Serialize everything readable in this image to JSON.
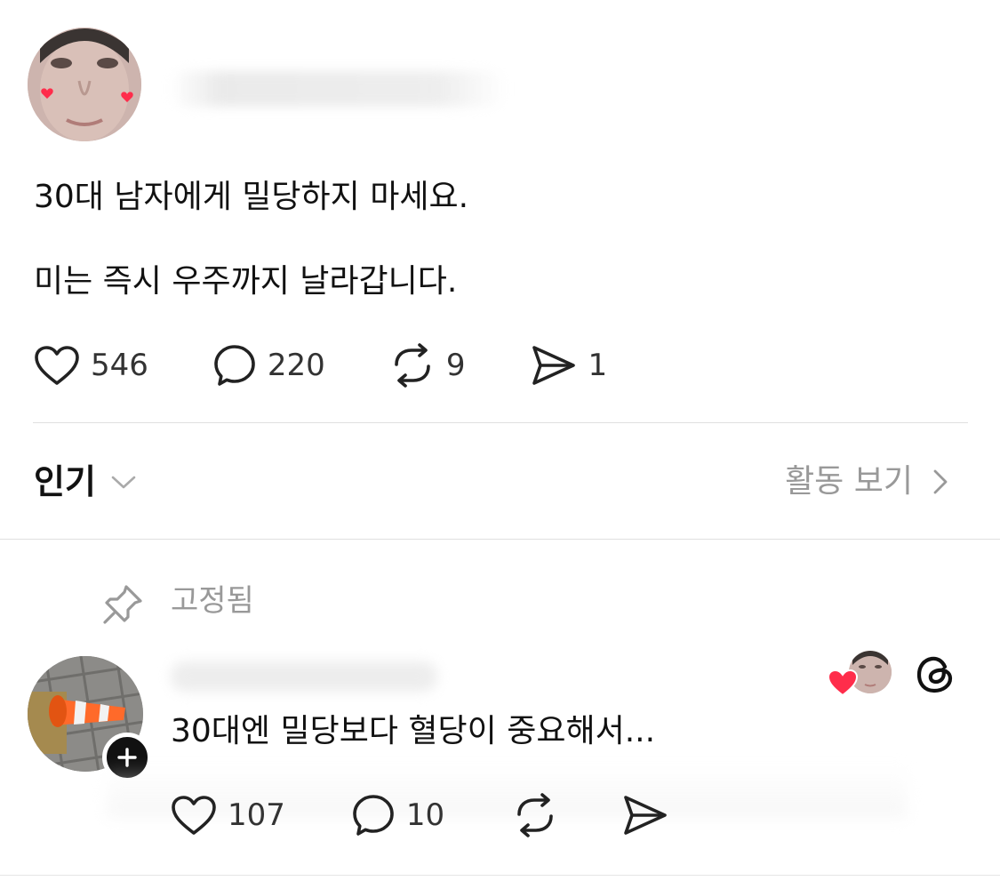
{
  "post": {
    "lines": [
      "30대 남자에게 밀당하지 마세요.",
      "미는 즉시 우주까지 날라갑니다."
    ],
    "likes": "546",
    "comments": "220",
    "reposts": "9",
    "shares": "1"
  },
  "sort": {
    "label": "인기",
    "activity_label": "활동 보기"
  },
  "reply": {
    "pinned_label": "고정됨",
    "text": "30대엔 밀당보다 혈당이 중요해서...",
    "likes": "107",
    "comments": "10"
  },
  "icons": {
    "like": "heart-icon",
    "comment": "comment-bubble-icon",
    "repost": "repost-icon",
    "share": "send-icon",
    "pin": "pin-icon",
    "chevron_down": "chevron-down-icon",
    "chevron_right": "chevron-right-icon",
    "threads": "threads-logo-icon",
    "plus": "plus-icon"
  },
  "colors": {
    "accent_heart": "#ff2d4b",
    "muted_text": "#999999",
    "text": "#111111"
  }
}
